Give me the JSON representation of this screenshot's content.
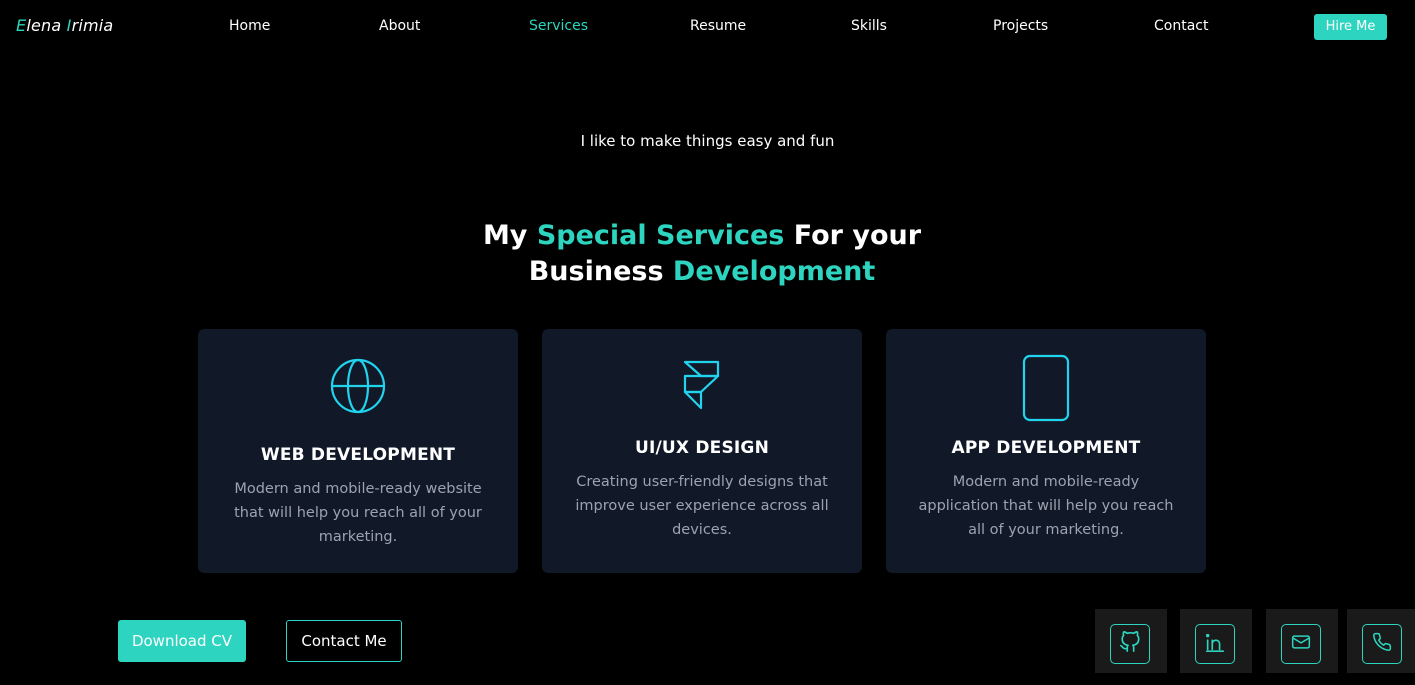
{
  "logo": {
    "first_initial": "E",
    "first_rest": "lena",
    "last_initial": "I",
    "last_rest": "rimia"
  },
  "nav": {
    "items": [
      "Home",
      "About",
      "Services",
      "Resume",
      "Skills",
      "Projects",
      "Contact"
    ],
    "active": "Services",
    "hire_label": "Hire Me"
  },
  "hero": {
    "tagline": "I like to make things easy and fun",
    "headline": {
      "part1": "My ",
      "accent1": "Special Services",
      "part2": " For your",
      "part3": "Business ",
      "accent2": "Development"
    }
  },
  "services": [
    {
      "icon": "globe-icon",
      "title": "WEB DEVELOPMENT",
      "description": "Modern and mobile-ready website that will help you reach all of your marketing."
    },
    {
      "icon": "framer-icon",
      "title": "UI/UX DESIGN",
      "description": "Creating user-friendly designs that improve user experience across all devices."
    },
    {
      "icon": "tablet-icon",
      "title": "APP DEVELOPMENT",
      "description": "Modern and mobile-ready application that will help you reach all of your marketing."
    }
  ],
  "actions": {
    "download_cv": "Download CV",
    "contact_me": "Contact Me"
  },
  "social": [
    "github-icon",
    "linkedin-icon",
    "mail-icon",
    "phone-icon"
  ],
  "colors": {
    "accent": "#2dd4bf",
    "card_bg": "#111827",
    "background": "#000000",
    "muted_text": "#9ca3af"
  }
}
